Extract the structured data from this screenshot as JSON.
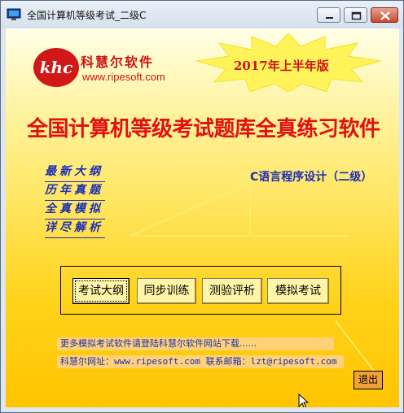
{
  "window": {
    "title": "全国计算机等级考试_二级C",
    "icon": "app-icon",
    "controls": [
      "minimize-icon",
      "maximize-icon",
      "close-icon"
    ]
  },
  "header": {
    "logo_text": "khc",
    "brand_name": "科慧尔软件",
    "brand_url": "www.ripesoft.com",
    "version_badge": "2017年上半年版"
  },
  "main": {
    "title": "全国计算机等级考试题库全真练习软件",
    "features": [
      "最新大纲",
      "历年真题",
      "全真模拟",
      "详尽解析"
    ],
    "subject": "C语言程序设计（二级）"
  },
  "buttons": [
    {
      "label": "考试大纲",
      "focused": true
    },
    {
      "label": "同步训练",
      "focused": false
    },
    {
      "label": "测验评析",
      "focused": false
    },
    {
      "label": "模拟考试",
      "focused": false
    }
  ],
  "footer": {
    "info_line": "更多模拟考试软件请登陆科慧尔软件网站下载......",
    "contact_line": "科慧尔网址：www.ripesoft.com  联系邮箱：lzt@ripesoft.com",
    "exit_label": "退出"
  },
  "colors": {
    "accent_red": "#e21111",
    "accent_blue": "#1d2fb5",
    "background_yellow": "#ffd21a"
  }
}
